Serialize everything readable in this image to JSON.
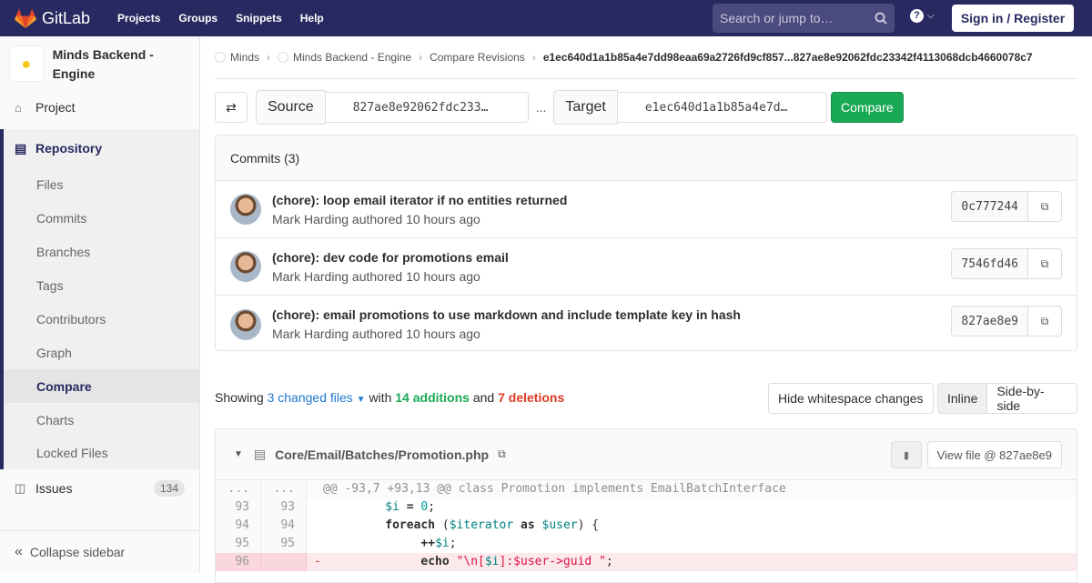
{
  "topbar": {
    "brand": "GitLab",
    "nav": [
      "Projects",
      "Groups",
      "Snippets",
      "Help"
    ],
    "search_placeholder": "Search or jump to…",
    "signin": "Sign in / Register"
  },
  "sidebar": {
    "project_name": "Minds Backend - Engine",
    "project_label": "Project",
    "repository_label": "Repository",
    "repo_items": [
      "Files",
      "Commits",
      "Branches",
      "Tags",
      "Contributors",
      "Graph",
      "Compare",
      "Charts",
      "Locked Files"
    ],
    "active_item": "Compare",
    "issues_label": "Issues",
    "issues_count": "134",
    "collapse_label": "Collapse sidebar"
  },
  "breadcrumb": {
    "items": [
      "Minds",
      "Minds Backend - Engine",
      "Compare Revisions"
    ],
    "current": "e1ec640d1a1b85a4e7dd98eaa69a2726fd9cf857...827ae8e92062fdc23342f4113068dcb4660078c7"
  },
  "compare_form": {
    "source_label": "Source",
    "source_value": "827ae8e92062fdc233…",
    "separator": "...",
    "target_label": "Target",
    "target_value": "e1ec640d1a1b85a4e7d…",
    "button": "Compare"
  },
  "commits": {
    "header": "Commits (3)",
    "items": [
      {
        "title": "(chore): loop email iterator if no entities returned",
        "author": "Mark Harding",
        "meta": "authored 10 hours ago",
        "sha": "0c777244"
      },
      {
        "title": "(chore): dev code for promotions email",
        "author": "Mark Harding",
        "meta": "authored 10 hours ago",
        "sha": "7546fd46"
      },
      {
        "title": "(chore): email promotions to use markdown and include template key in hash",
        "author": "Mark Harding",
        "meta": "authored 10 hours ago",
        "sha": "827ae8e9"
      }
    ]
  },
  "summary": {
    "showing": "Showing",
    "files": "3 changed files",
    "with": "with",
    "additions": "14 additions",
    "and": "and",
    "deletions": "7 deletions"
  },
  "view_controls": {
    "whitespace": "Hide whitespace changes",
    "inline": "Inline",
    "side_by_side": "Side-by-side"
  },
  "diff": {
    "file_path": "Core/Email/Batches/Promotion.php",
    "view_file": "View file @ 827ae8e9",
    "lines": [
      {
        "old": "...",
        "new": "...",
        "type": "meta",
        "text": "@@ -93,7 +93,13 @@ class Promotion implements EmailBatchInterface"
      },
      {
        "old": "93",
        "new": "93",
        "type": "ctx",
        "text": "        $i = 0;"
      },
      {
        "old": "94",
        "new": "94",
        "type": "ctx",
        "text": "        foreach ($iterator as $user) {"
      },
      {
        "old": "95",
        "new": "95",
        "type": "ctx",
        "text": "            ++$i;"
      },
      {
        "old": "96",
        "new": "",
        "type": "del",
        "text": "            echo \"\\n[$i]:$user->guid \";"
      }
    ]
  }
}
